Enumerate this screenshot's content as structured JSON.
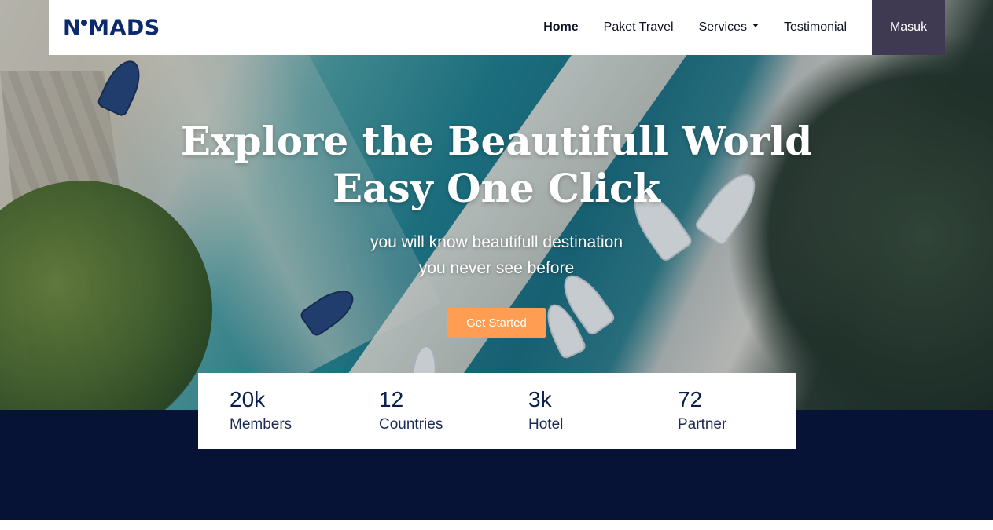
{
  "brand": {
    "name": "NOMADS",
    "prefix": "N",
    "suffix": "MADS"
  },
  "nav": {
    "items": [
      {
        "label": "Home",
        "active": true
      },
      {
        "label": "Paket Travel",
        "active": false
      },
      {
        "label": "Services",
        "active": false,
        "dropdown": true
      },
      {
        "label": "Testimonial",
        "active": false
      }
    ],
    "login_label": "Masuk"
  },
  "hero": {
    "title_line1": "Explore the Beautifull World",
    "title_line2": "Easy One Click",
    "subtitle_line1": "you will know beautifull destination",
    "subtitle_line2": "you never see before",
    "cta_label": "Get Started"
  },
  "stats": [
    {
      "value": "20k",
      "label": "Members"
    },
    {
      "value": "12",
      "label": "Countries"
    },
    {
      "value": "3k",
      "label": "Hotel"
    },
    {
      "value": "72",
      "label": "Partner"
    }
  ],
  "colors": {
    "brand": "#0b2a6b",
    "login_bg": "#3f3a52",
    "cta": "#ff9e53",
    "dark_section": "#071336"
  }
}
